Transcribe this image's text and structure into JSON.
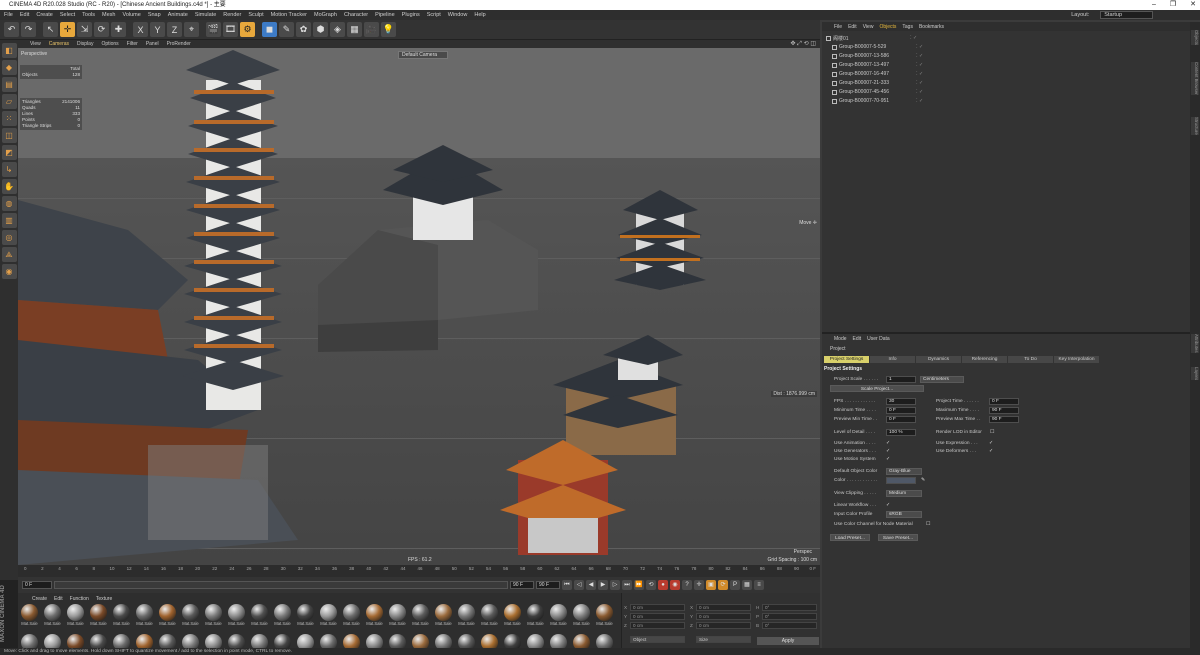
{
  "window": {
    "title": "CINEMA 4D R20.028 Studio (RC - R20) - [Chinese Ancient Buildings.c4d *] - 主要",
    "min": "–",
    "max": "❐",
    "close": "✕"
  },
  "menubar": {
    "items": [
      "File",
      "Edit",
      "Create",
      "Select",
      "Tools",
      "Mesh",
      "Volume",
      "Snap",
      "Animate",
      "Simulate",
      "Render",
      "Sculpt",
      "Motion Tracker",
      "MoGraph",
      "Character",
      "Pipeline",
      "Plugins",
      "Script",
      "Window",
      "Help"
    ],
    "layout_label": "Layout:",
    "layout_value": "Startup"
  },
  "toolbar": {
    "axis_x": "X",
    "axis_y": "Y",
    "axis_z": "Z"
  },
  "viewport": {
    "menu": [
      "View",
      "Cameras",
      "Display",
      "Options",
      "Filter",
      "Panel",
      "ProRender"
    ],
    "projection": "Perspective",
    "camera": "Default Camera",
    "stats_header": "Total",
    "stats_objects_label": "Objects",
    "stats_objects_value": "128",
    "stats": [
      {
        "label": "Triangles",
        "value": "2141006"
      },
      {
        "label": "Quads",
        "value": "11"
      },
      {
        "label": "Lines",
        "value": "333"
      },
      {
        "label": "Points",
        "value": "0"
      },
      {
        "label": "Triangle Strips",
        "value": "0"
      }
    ],
    "move_label": "Move ✛",
    "distance": "Dist : 1876.999 cm",
    "fps": "FPS : 61.2",
    "bottom_projection": "Perspec",
    "grid_spacing": "Grid Spacing : 100 cm"
  },
  "timeline": {
    "ticks": [
      "0",
      "2",
      "4",
      "6",
      "8",
      "10",
      "12",
      "14",
      "16",
      "18",
      "20",
      "22",
      "24",
      "26",
      "28",
      "30",
      "32",
      "34",
      "36",
      "38",
      "40",
      "42",
      "44",
      "46",
      "48",
      "50",
      "52",
      "54",
      "56",
      "58",
      "60",
      "62",
      "64",
      "66",
      "68",
      "70",
      "72",
      "74",
      "76",
      "78",
      "80",
      "82",
      "84",
      "86",
      "88",
      "90"
    ],
    "end_label": "0 F"
  },
  "playback": {
    "start_field": "0 F",
    "current_field": "0 F",
    "end_field": "90 F",
    "end_field2": "90 F"
  },
  "materials": {
    "menu": [
      "Create",
      "Edit",
      "Function",
      "Texture"
    ],
    "label": "Mat.Sale",
    "colors": [
      "#8a5a30",
      "#6e6e6e",
      "#9a9a9a",
      "#7a4a28",
      "#4a4a4a",
      "#6a6a6a",
      "#a0632e",
      "#5a5a5a",
      "#7b7b7b",
      "#8c8c8c",
      "#505050",
      "#7a7a7a",
      "#444444",
      "#9a9a9a",
      "#6b6b6b",
      "#a56a33",
      "#888888",
      "#5c5c5c",
      "#9a6a3c",
      "#777777",
      "#5a5a5a",
      "#a96e2f",
      "#3e3e3e",
      "#8a8a8a",
      "#7f7f7f"
    ]
  },
  "coords": {
    "labels": [
      "X",
      "Y",
      "Z"
    ],
    "size_labels": [
      "X",
      "Y",
      "Z"
    ],
    "rot_labels": [
      "H",
      "P",
      "B"
    ],
    "unit_a": "0 cm",
    "unit_b": "0 cm",
    "unit_c": "0°",
    "mode1": "Object",
    "mode2": "Size",
    "apply": "Apply"
  },
  "maxon": "MAXON CINEMA 4D",
  "status": "Move: Click and drag to move elements. Hold down SHIFT to quantize movement / add to the selection in point mode, CTRL to remove.",
  "objects": {
    "menu": [
      "File",
      "Edit",
      "View",
      "Objects",
      "Tags",
      "Bookmarks"
    ],
    "active": "Objects",
    "items": [
      "阁楼01",
      "Group-B00007-5-529",
      "Group-B00007-13-586",
      "Group-B00007-13-497",
      "Group-B00007-16-497",
      "Group-B00007-21-333",
      "Group-B00007-45-456",
      "Group-B00007-70-951"
    ]
  },
  "attributes": {
    "menu": [
      "Mode",
      "Edit",
      "User Data"
    ],
    "title": "Project",
    "tabs": [
      "Project Settings",
      "Info",
      "Dynamics",
      "Referencing",
      "To Do",
      "Key Interpolation"
    ],
    "heading": "Project Settings",
    "project_scale_label": "Project Scale . . . . . .",
    "project_scale_value": "1",
    "project_scale_unit": "Centimeters",
    "scale_button": "Scale Project...",
    "fps_label": "FPS . . . . . . . . . . . .",
    "fps_value": "30",
    "min_time_label": "Minimum Time . . . .",
    "min_time_value": "0 F",
    "preview_min_label": "Preview Min Time . .",
    "preview_min_value": "0 F",
    "project_time_label": "Project Time . . . . . .",
    "project_time_value": "0 F",
    "max_time_label": "Maximum Time . . . .",
    "max_time_value": "90 F",
    "preview_max_label": "Preview Max Time . .",
    "preview_max_value": "90 F",
    "lod_label": "Level of Detail . . . .",
    "lod_value": "100 %",
    "render_lod_label": "Render LOD in Editor",
    "use_animation": "Use Animation . . . .",
    "use_expression": "Use Expression . . .",
    "use_generators": "Use Generators . . .",
    "use_deformers": "Use Deformers . . .",
    "use_motion": "Use Motion System",
    "default_color_label": "Default Object Color",
    "default_color_value": "Gray-Blue",
    "color_label": "Color . . . . . . . . . . . .",
    "view_clipping_label": "View Clipping . . . . .",
    "view_clipping_value": "Medium",
    "linear_label": "Linear Workflow . . .",
    "input_profile_label": "Input Color Profile",
    "input_profile_value": "sRGB",
    "use_color_channel": "Use Color Channel for Node Material",
    "check": "✓",
    "load_preset": "Load Preset...",
    "save_preset": "Save Preset..."
  },
  "right_strip": [
    "Objects",
    "Content Browser",
    "Structure",
    "Attributes",
    "Layers"
  ]
}
